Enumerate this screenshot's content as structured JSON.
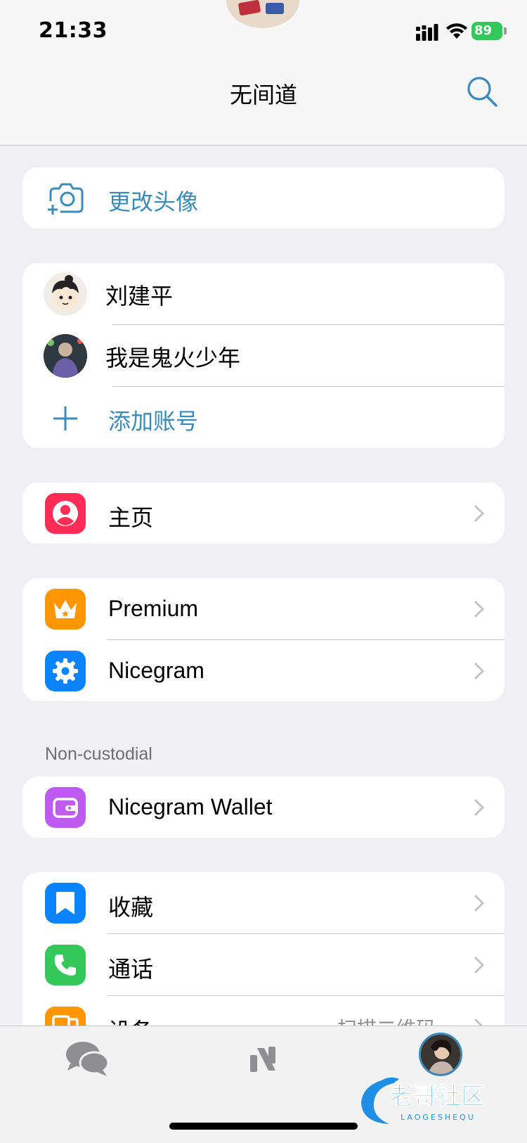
{
  "status_bar": {
    "time": "21:33",
    "battery": "89"
  },
  "header": {
    "title": "无间道"
  },
  "avatar_card": {
    "label": "更改头像"
  },
  "accounts": [
    {
      "name": "刘建平"
    },
    {
      "name": "我是鬼火少年"
    }
  ],
  "add_account": {
    "label": "添加账号"
  },
  "profile_card": {
    "label": "主页"
  },
  "premium_card": {
    "items": [
      {
        "label": "Premium"
      },
      {
        "label": "Nicegram"
      }
    ]
  },
  "wallet_section": {
    "title": "Non-custodial",
    "label": "Nicegram Wallet"
  },
  "tools_card": {
    "items": [
      {
        "label": "收藏"
      },
      {
        "label": "通话"
      },
      {
        "label": "设备",
        "detail": "扫描二维码"
      }
    ]
  },
  "watermark": {
    "text": "老哥社区",
    "sub": "LAOGESHEQU"
  },
  "colors": {
    "accent": "#3a8bbd",
    "profile": "#ff2d55",
    "premium": "#ff9500",
    "nicegram": "#0a84ff",
    "wallet": "#bf5af2",
    "saved": "#0a84ff",
    "calls": "#34c759",
    "devices": "#ff9500"
  }
}
